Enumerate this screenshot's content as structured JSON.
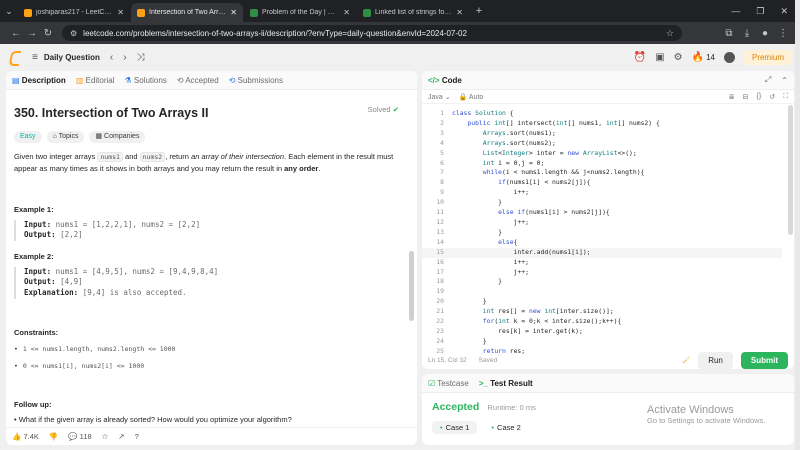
{
  "browser": {
    "tabs": [
      {
        "title": "joshiparas217 - LeetCode Profi...",
        "color": "#ffa116",
        "active": false
      },
      {
        "title": "Intersection of Two Arrays II - L...",
        "color": "#ffa116",
        "active": true
      },
      {
        "title": "Problem of the Day | GeeksforG...",
        "color": "#2f8d46",
        "active": false
      },
      {
        "title": "Linked list of strings forms a pa...",
        "color": "#2f8d46",
        "active": false
      }
    ],
    "url": "leetcode.com/problems/intersection-of-two-arrays-ii/description/?envType=daily-question&envId=2024-07-02"
  },
  "header": {
    "daily": "Daily Question",
    "streak": "14",
    "premium": "Premium"
  },
  "left_tabs": [
    "Description",
    "Editorial",
    "Solutions",
    "Accepted",
    "Submissions"
  ],
  "problem": {
    "title": "350. Intersection of Two Arrays II",
    "solved": "Solved",
    "tags": [
      "Easy",
      "Topics",
      "Companies"
    ],
    "desc_1": "Given two integer arrays ",
    "nums1": "nums1",
    "desc_2": " and ",
    "nums2": "nums2",
    "desc_3": ", return ",
    "desc_em": "an array of their intersection",
    "desc_4": ". Each element in the result must appear as many times as it shows in both arrays and you may return the result in ",
    "desc_bold": "any order",
    "desc_5": ".",
    "examples": [
      {
        "head": "Example 1:",
        "input_label": "Input:",
        "input": " nums1 = [1,2,2,1], nums2 = [2,2]",
        "output_label": "Output:",
        "output": " [2,2]",
        "expl_label": "",
        "expl": ""
      },
      {
        "head": "Example 2:",
        "input_label": "Input:",
        "input": " nums1 = [4,9,5], nums2 = [9,4,9,8,4]",
        "output_label": "Output:",
        "output": " [4,9]",
        "expl_label": "Explanation:",
        "expl": " [9,4] is also accepted."
      }
    ],
    "constraints_head": "Constraints:",
    "constraints": [
      "1 <= nums1.length, nums2.length <= 1000",
      "0 <= nums1[i], nums2[i] <= 1000"
    ],
    "followup_head": "Follow up:",
    "followup": "What if the given array is already sorted? How would you optimize your algorithm?",
    "likes": "7.4K",
    "comments": "118"
  },
  "code": {
    "title": "Code",
    "lang": "Java",
    "auto": "Auto",
    "lines": [
      "class Solution {",
      "    public int[] intersect(int[] nums1, int[] nums2) {",
      "        Arrays.sort(nums1);",
      "        Arrays.sort(nums2);",
      "        List<Integer> inter = new ArrayList<>();",
      "        int i = 0,j = 0;",
      "        while(i < nums1.length && j<nums2.length){",
      "            if(nums1[i] < nums2[j]){",
      "                i++;",
      "            }",
      "            else if(nums1[i] > nums2[j]){",
      "                j++;",
      "            }",
      "            else{",
      "                inter.add(nums1[i]);",
      "                i++;",
      "                j++;",
      "            }",
      "",
      "        }",
      "        int res[] = new int[inter.size()];",
      "        for(int k = 0;k < inter.size();k++){",
      "            res[k] = inter.get(k);",
      "        }",
      "        return res;"
    ],
    "current_line": 15,
    "cursor": "Ln 15, Col 32",
    "saved": "Saved",
    "run": "Run",
    "submit": "Submit"
  },
  "test": {
    "tabs": [
      "Testcase",
      "Test Result"
    ],
    "status": "Accepted",
    "runtime": "Runtime: 0 ms",
    "cases": [
      "Case 1",
      "Case 2"
    ]
  },
  "watermark": {
    "title": "Activate Windows",
    "sub": "Go to Settings to activate Windows."
  }
}
